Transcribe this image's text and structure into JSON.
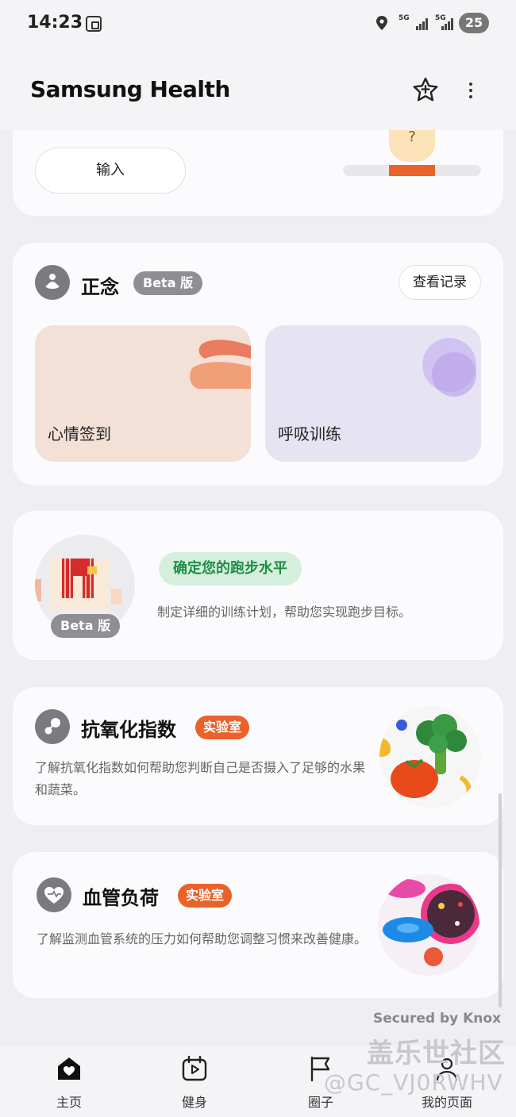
{
  "status_bar": {
    "time": "14:23",
    "network_1": "5G",
    "network_2": "5G",
    "battery": "25"
  },
  "header": {
    "title": "Samsung Health"
  },
  "card_partial": {
    "input_label": "输入",
    "bubble": "?"
  },
  "mindfulness": {
    "title": "正念",
    "badge": "Beta 版",
    "history_label": "查看记录",
    "tiles": [
      {
        "label": "心情签到"
      },
      {
        "label": "呼吸训练"
      }
    ]
  },
  "running": {
    "badge": "Beta 版",
    "pill": "确定您的跑步水平",
    "desc": "制定详细的训练计划，帮助您实现跑步目标。"
  },
  "antioxidant": {
    "title": "抗氧化指数",
    "badge": "实验室",
    "desc": "了解抗氧化指数如何帮助您判断自己是否摄入了足够的水果和蔬菜。"
  },
  "vascular": {
    "title": "血管负荷",
    "badge": "实验室",
    "desc": "了解监测血管系统的压力如何帮助您调整习惯来改善健康。"
  },
  "footer": {
    "knox": "Secured by Knox",
    "watermark": "盖乐世社区",
    "watermark_id": "@GC_VJ0RWHV"
  },
  "nav": {
    "items": [
      {
        "label": "主页"
      },
      {
        "label": "健身"
      },
      {
        "label": "圈子"
      },
      {
        "label": "我的页面"
      }
    ]
  },
  "colors": {
    "accent": "#e8622a",
    "green": "#1f8d45",
    "badge_grey": "#8e8e93"
  },
  "icons": [
    "screenshot-icon",
    "location-icon",
    "star-icon",
    "more-icon",
    "meditation-icon",
    "antioxidant-icon",
    "heart-icon",
    "home-icon",
    "fitness-icon",
    "flag-icon",
    "profile-icon"
  ]
}
